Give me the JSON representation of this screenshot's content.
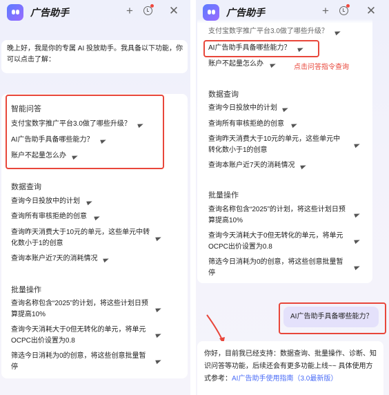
{
  "app": {
    "title": "广告助手"
  },
  "header_icons": [
    "plus-icon",
    "history-icon",
    "close-icon"
  ],
  "left": {
    "greeting": "晚上好，我是你的专属 AI 投放助手。我具备以下功能，你可以点击了解：",
    "qa": {
      "title": "智能问答",
      "items": [
        "支付宝数字推广平台3.0做了哪些升级？",
        "AI广告助手具备哪些能力？",
        "账户不起量怎么办"
      ]
    },
    "data_query": {
      "title": "数据查询",
      "items": [
        "查询今日投放中的计划",
        "查询所有审核拒绝的创意",
        "查询昨天消费大于10元的单元，这些单元中转化数小于1的创意",
        "查询本账户近7天的消耗情况"
      ]
    },
    "batch": {
      "title": "批量操作",
      "items": [
        "查询名称包含“2025”的计划，将这些计划日预算提高10%",
        "查询今天消耗大于0但无转化的单元，将单元OCPC出价设置为0.8",
        "筛选今日消耗为0的创意，将这些创意批量暂停"
      ]
    }
  },
  "right": {
    "cut_text": "支付宝数字推广平台3.0做了哪些升级？",
    "qa_items": [
      "AI广告助手具备哪些能力？",
      "账户不起量怎么办"
    ],
    "annotation": "点击问答指令查询",
    "data_query": {
      "title": "数据查询",
      "items": [
        "查询今日投放中的计划",
        "查询所有审核拒绝的创意",
        "查询昨天消费大于10元的单元，这些单元中转化数小于1的创意",
        "查询本账户近7天的消耗情况"
      ]
    },
    "batch": {
      "title": "批量操作",
      "items": [
        "查询名称包含“2025”的计划，将这些计划日预算提高10%",
        "查询今天消耗大于0但无转化的单元，将单元OCPC出价设置为0.8",
        "筛选今日消耗为0的创意，将这些创意批量暂停"
      ]
    },
    "user_message": "AI广告助手具备哪些能力？",
    "reply_text": "你好，目前我已经支持：数据查询、批量操作、诊断、知识问答等功能，后续还会有更多功能上线~~ 具体使用方式参考：",
    "reply_link": "AI广告助手使用指南（3.0最新版）"
  },
  "colors": {
    "annotation_red": "#e8463a",
    "link_blue": "#4a6cf7",
    "user_bubble": "#e4e1fb"
  }
}
